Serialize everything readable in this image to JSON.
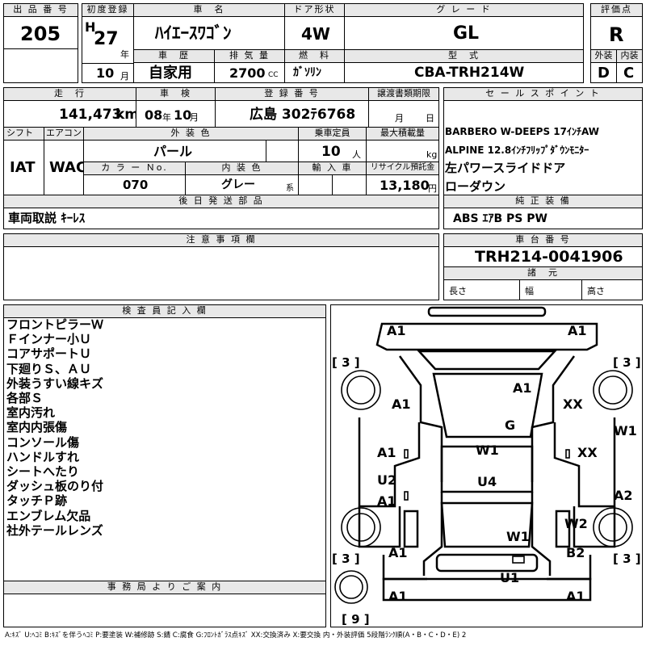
{
  "headers": {
    "lot_no": "出 品 番 号",
    "first_reg": "初度登録",
    "car_name": "車　名",
    "door": "ドア形状",
    "grade": "グ レ ー ド",
    "score": "評価点",
    "history": "車　歴",
    "displacement": "排 気 量",
    "fuel": "燃　料",
    "model": "型　式",
    "exterior": "外装",
    "interior": "内装",
    "mileage": "走　行",
    "inspection": "車　検",
    "reg_no": "登 録 番 号",
    "transfer": "譲渡書類期限",
    "sales_point": "セ ー ル ス ポ イ ン ト",
    "shift": "シフト",
    "aircon": "エアコン",
    "ext_color": "外 装 色",
    "capacity": "乗車定員",
    "max_load": "最大積載量",
    "color_no": "カ ラ ー Ｎo.",
    "int_color": "内 装 色",
    "import": "輸 入 車",
    "recycle": "リサイクル預託金",
    "genuine": "純 正 装 備",
    "later_parts": "後 日 発 送 部 品",
    "notes": "注 意 事 項 欄",
    "chassis": "車 台 番 号",
    "dimensions": "諸　元",
    "inspector": "検 査 員 記 入 欄",
    "office": "事 務 局 よ り ご 案 内"
  },
  "lot_number": "205",
  "era": "H",
  "year": "27",
  "year_unit": "年",
  "month": "10",
  "month_unit": "月",
  "car_name": "ﾊｲｴｰｽﾜｺﾞﾝ",
  "door": "4W",
  "grade": "GL",
  "score": "R",
  "history": "自家用",
  "displacement": "2700",
  "displacement_unit": "CC",
  "fuel": "ｶﾞｿﾘﾝ",
  "model": "CBA-TRH214W",
  "exterior_grade": "D",
  "interior_grade": "C",
  "mileage": "141,473",
  "mileage_unit": "km",
  "insp_year": "08",
  "insp_year_unit": "年",
  "insp_month": "10",
  "insp_month_unit": "月",
  "reg_no": "広島 302ﾃ6768",
  "transfer_month_unit": "月",
  "transfer_day_unit": "日",
  "sales_points": [
    "BARBERO W-DEEPS 17ｲﾝﾁAW",
    "ALPINE 12.8ｲﾝﾁﾌﾘｯﾌﾟﾀﾞｳﾝﾓﾆﾀｰ",
    "左パワースライドドア",
    "ローダウン"
  ],
  "shift": "IAT",
  "aircon": "WAC",
  "ext_color": "パール",
  "capacity": "10",
  "capacity_unit": "人",
  "max_load_unit": "kg",
  "color_no": "070",
  "int_color": "グレー",
  "int_color_unit": "系",
  "recycle": "13,180",
  "recycle_unit": "円",
  "genuine": "ABS ｴｱB PS PW",
  "later_parts": "車両取説 ｷｰﾚｽ",
  "chassis": "TRH214-0041906",
  "dim_length": "長さ",
  "dim_width": "幅",
  "dim_height": "高さ",
  "inspector_notes": [
    "フロントピラーＷ",
    "Ｆインナー小Ｕ",
    "コアサポートＵ",
    "下廻りＳ、ＡＵ",
    "外装うすい線キズ",
    "各部Ｓ",
    "室内汚れ",
    "室内内張傷",
    "コンソール傷",
    "ハンドルすれ",
    "シートへたり",
    "ダッシュ板のり付",
    "タッチＰ跡",
    "エンブレム欠品",
    "社外テールレンズ"
  ],
  "diagram": {
    "tire_tl": "[ 3 ]",
    "tire_tr": "[ 3 ]",
    "tire_bl": "[ 3 ]",
    "tire_br": "[ 3 ]",
    "spare": "[ 9 ]",
    "marks": [
      "A1",
      "A1",
      "A1",
      "A1",
      "XX",
      "G",
      "W1",
      "A1",
      "XX",
      "W1",
      "U2",
      "A1",
      "U4",
      "A2",
      "W2",
      "W1",
      "A1",
      "B2",
      "U1",
      "A1",
      "A1"
    ]
  },
  "legend": "A:ｷｽﾞ U:ﾍｺﾐ B:ｷｽﾞを伴うﾍｺﾐ P:要塗装 W:補修跡 S:錆 C:腐食 G:ﾌﾛﾝﾄｶﾞﾗｽ点ｷｽﾞ XX:交換済み X:要交換 内・外装評価 5段階ﾗﾝｸ順(A・B・C・D・E) 2"
}
